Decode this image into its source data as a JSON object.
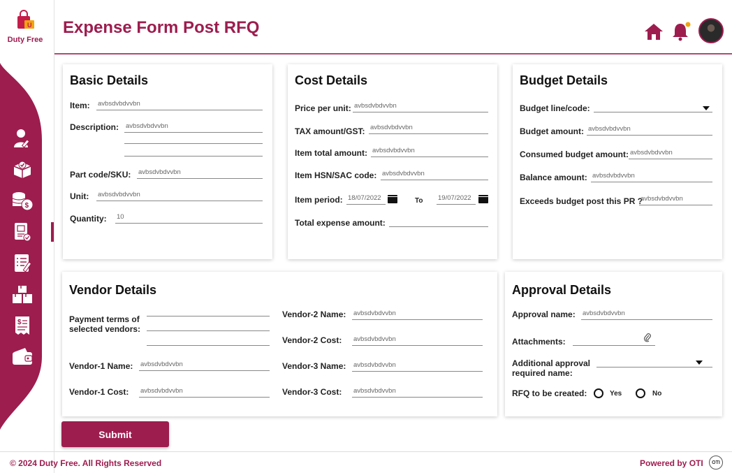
{
  "brand": {
    "name": "Duty Free"
  },
  "header": {
    "title": "Expense Form Post RFQ"
  },
  "sidebar": {
    "items": [
      {
        "icon": "user-edit-icon"
      },
      {
        "icon": "box-check-icon"
      },
      {
        "icon": "coins-dollar-icon"
      },
      {
        "icon": "invoice-check-icon"
      },
      {
        "icon": "checklist-icon"
      },
      {
        "icon": "boxes-icon"
      },
      {
        "icon": "receipt-dollar-icon"
      },
      {
        "icon": "wallet-icon"
      }
    ]
  },
  "basic": {
    "title": "Basic Details",
    "item_label": "Item:",
    "item_value": "avbsdvbdvvbn",
    "description_label": "Description:",
    "description_value": "avbsdvbdvvbn",
    "part_label": "Part code/SKU:",
    "part_value": "avbsdvbdvvbn",
    "unit_label": "Unit:",
    "unit_value": "avbsdvbdvvbn",
    "quantity_label": "Quantity:",
    "quantity_value": "10"
  },
  "cost": {
    "title": "Cost Details",
    "price_label": "Price per unit:",
    "price_value": "avbsdvbdvvbn",
    "tax_label": "TAX amount/GST:",
    "tax_value": "avbsdvbdvvbn",
    "total_label": "Item total amount:",
    "total_value": "avbsdvbdvvbn",
    "hsn_label": "Item HSN/SAC code:",
    "hsn_value": "avbsdvbdvvbn",
    "period_label": "Item period:",
    "period_from": "18/07/2022",
    "period_to_label": "To",
    "period_to": "19/07/2022",
    "expense_label": "Total expense amount:",
    "expense_value": ""
  },
  "budget": {
    "title": "Budget Details",
    "line_label": "Budget line/code:",
    "line_value": "",
    "amount_label": "Budget amount:",
    "amount_value": "avbsdvbdvvbn",
    "consumed_label": "Consumed budget amount:",
    "consumed_value": "avbsdvbdvvbn",
    "balance_label": "Balance amount:",
    "balance_value": "avbsdvbdvvbn",
    "exceeds_label": "Exceeds budget post this PR ?",
    "exceeds_value": "avbsdvbdvvbn"
  },
  "vendor": {
    "title": "Vendor Details",
    "payment_label": "Payment terms of selected vendors:",
    "v1_name_label": "Vendor-1 Name:",
    "v1_name_value": "avbsdvbdvvbn",
    "v1_cost_label": "Vendor-1 Cost:",
    "v1_cost_value": "avbsdvbdvvbn",
    "v2_name_label": "Vendor-2 Name:",
    "v2_name_value": "avbsdvbdvvbn",
    "v2_cost_label": "Vendor-2 Cost:",
    "v2_cost_value": "avbsdvbdvvbn",
    "v3_name_label": "Vendor-3 Name:",
    "v3_name_value": "avbsdvbdvvbn",
    "v3_cost_label": "Vendor-3 Cost:",
    "v3_cost_value": "avbsdvbdvvbn"
  },
  "approval": {
    "title": "Approval Details",
    "name_label": "Approval name:",
    "name_value": "avbsdvbdvvbn",
    "attachments_label": "Attachments:",
    "additional_label": "Additional approval required name:",
    "rfq_label": "RFQ to be created:",
    "yes_label": "Yes",
    "no_label": "No"
  },
  "actions": {
    "submit_label": "Submit"
  },
  "footer": {
    "copyright": "© 2024 Duty Free. All Rights Reserved",
    "powered": "Powered by OTI",
    "logo_text": "OTI"
  },
  "colors": {
    "accent": "#9d1d4e"
  }
}
